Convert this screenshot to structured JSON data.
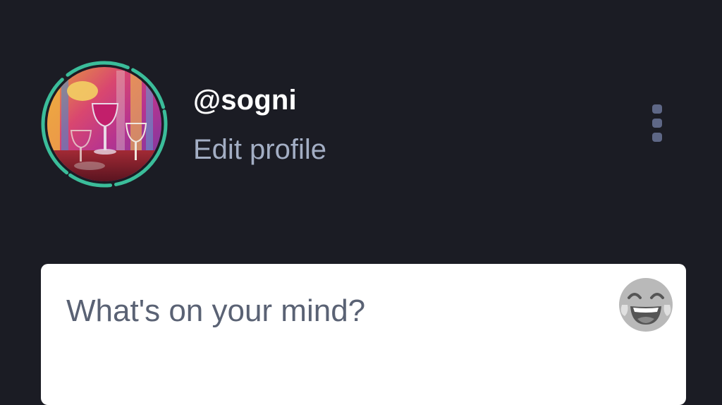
{
  "profile": {
    "username": "@sogni",
    "edit_profile_label": "Edit profile",
    "avatar": {
      "description_icon": "avatar-artwork"
    },
    "menu": {
      "icon": "more-vertical-icon"
    }
  },
  "composer": {
    "placeholder": "What's on your mind?",
    "emoji_icon": "laughing-emoji-icon"
  },
  "colors": {
    "background": "#1b1c24",
    "username": "#ffffff",
    "edit_profile": "#a3aec4",
    "ring": "#3bbd9a",
    "menu_dots": "#5e6786",
    "composer_bg": "#ffffff",
    "placeholder": "#5a6274"
  }
}
